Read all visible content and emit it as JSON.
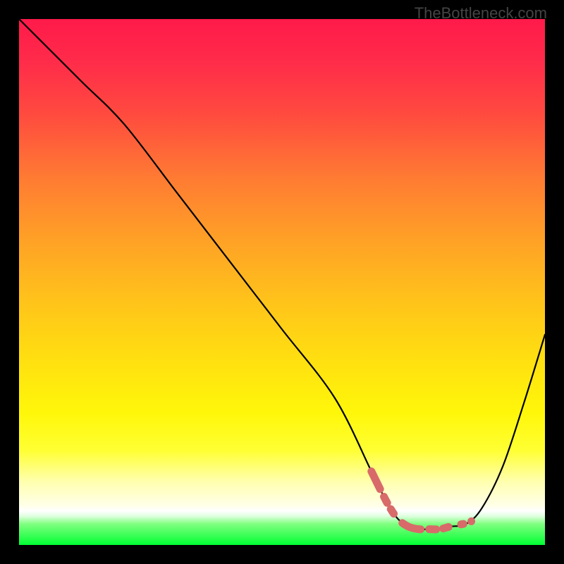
{
  "watermark": "TheBottleneck.com",
  "chart_data": {
    "type": "line",
    "title": "",
    "xlabel": "",
    "ylabel": "",
    "xlim": [
      0,
      100
    ],
    "ylim": [
      0,
      100
    ],
    "series": [
      {
        "name": "bottleneck-curve",
        "x": [
          0,
          5,
          12,
          20,
          30,
          40,
          50,
          60,
          67,
          70,
          72,
          74,
          76,
          78,
          80,
          82,
          85,
          88,
          92,
          96,
          100
        ],
        "values": [
          100,
          95,
          88,
          80,
          67,
          54,
          41,
          28,
          14,
          8,
          5,
          3.5,
          3,
          3,
          3,
          3.5,
          4,
          7,
          15,
          27,
          40
        ]
      }
    ],
    "highlight_segment": {
      "name": "bottleneck-range",
      "x": [
        67,
        70,
        72,
        74,
        76,
        78,
        80,
        82,
        84.5
      ],
      "values": [
        14,
        8,
        5,
        3.5,
        3,
        3,
        3,
        3.5,
        4
      ]
    },
    "highlight_dot": {
      "x": 86,
      "y": 4.5
    },
    "gradient_stops": [
      {
        "pos": 0,
        "color": "#ff1a4a"
      },
      {
        "pos": 0.5,
        "color": "#ffc41a"
      },
      {
        "pos": 0.82,
        "color": "#ffff33"
      },
      {
        "pos": 0.93,
        "color": "#ffffff"
      },
      {
        "pos": 1.0,
        "color": "#00ff33"
      }
    ]
  }
}
